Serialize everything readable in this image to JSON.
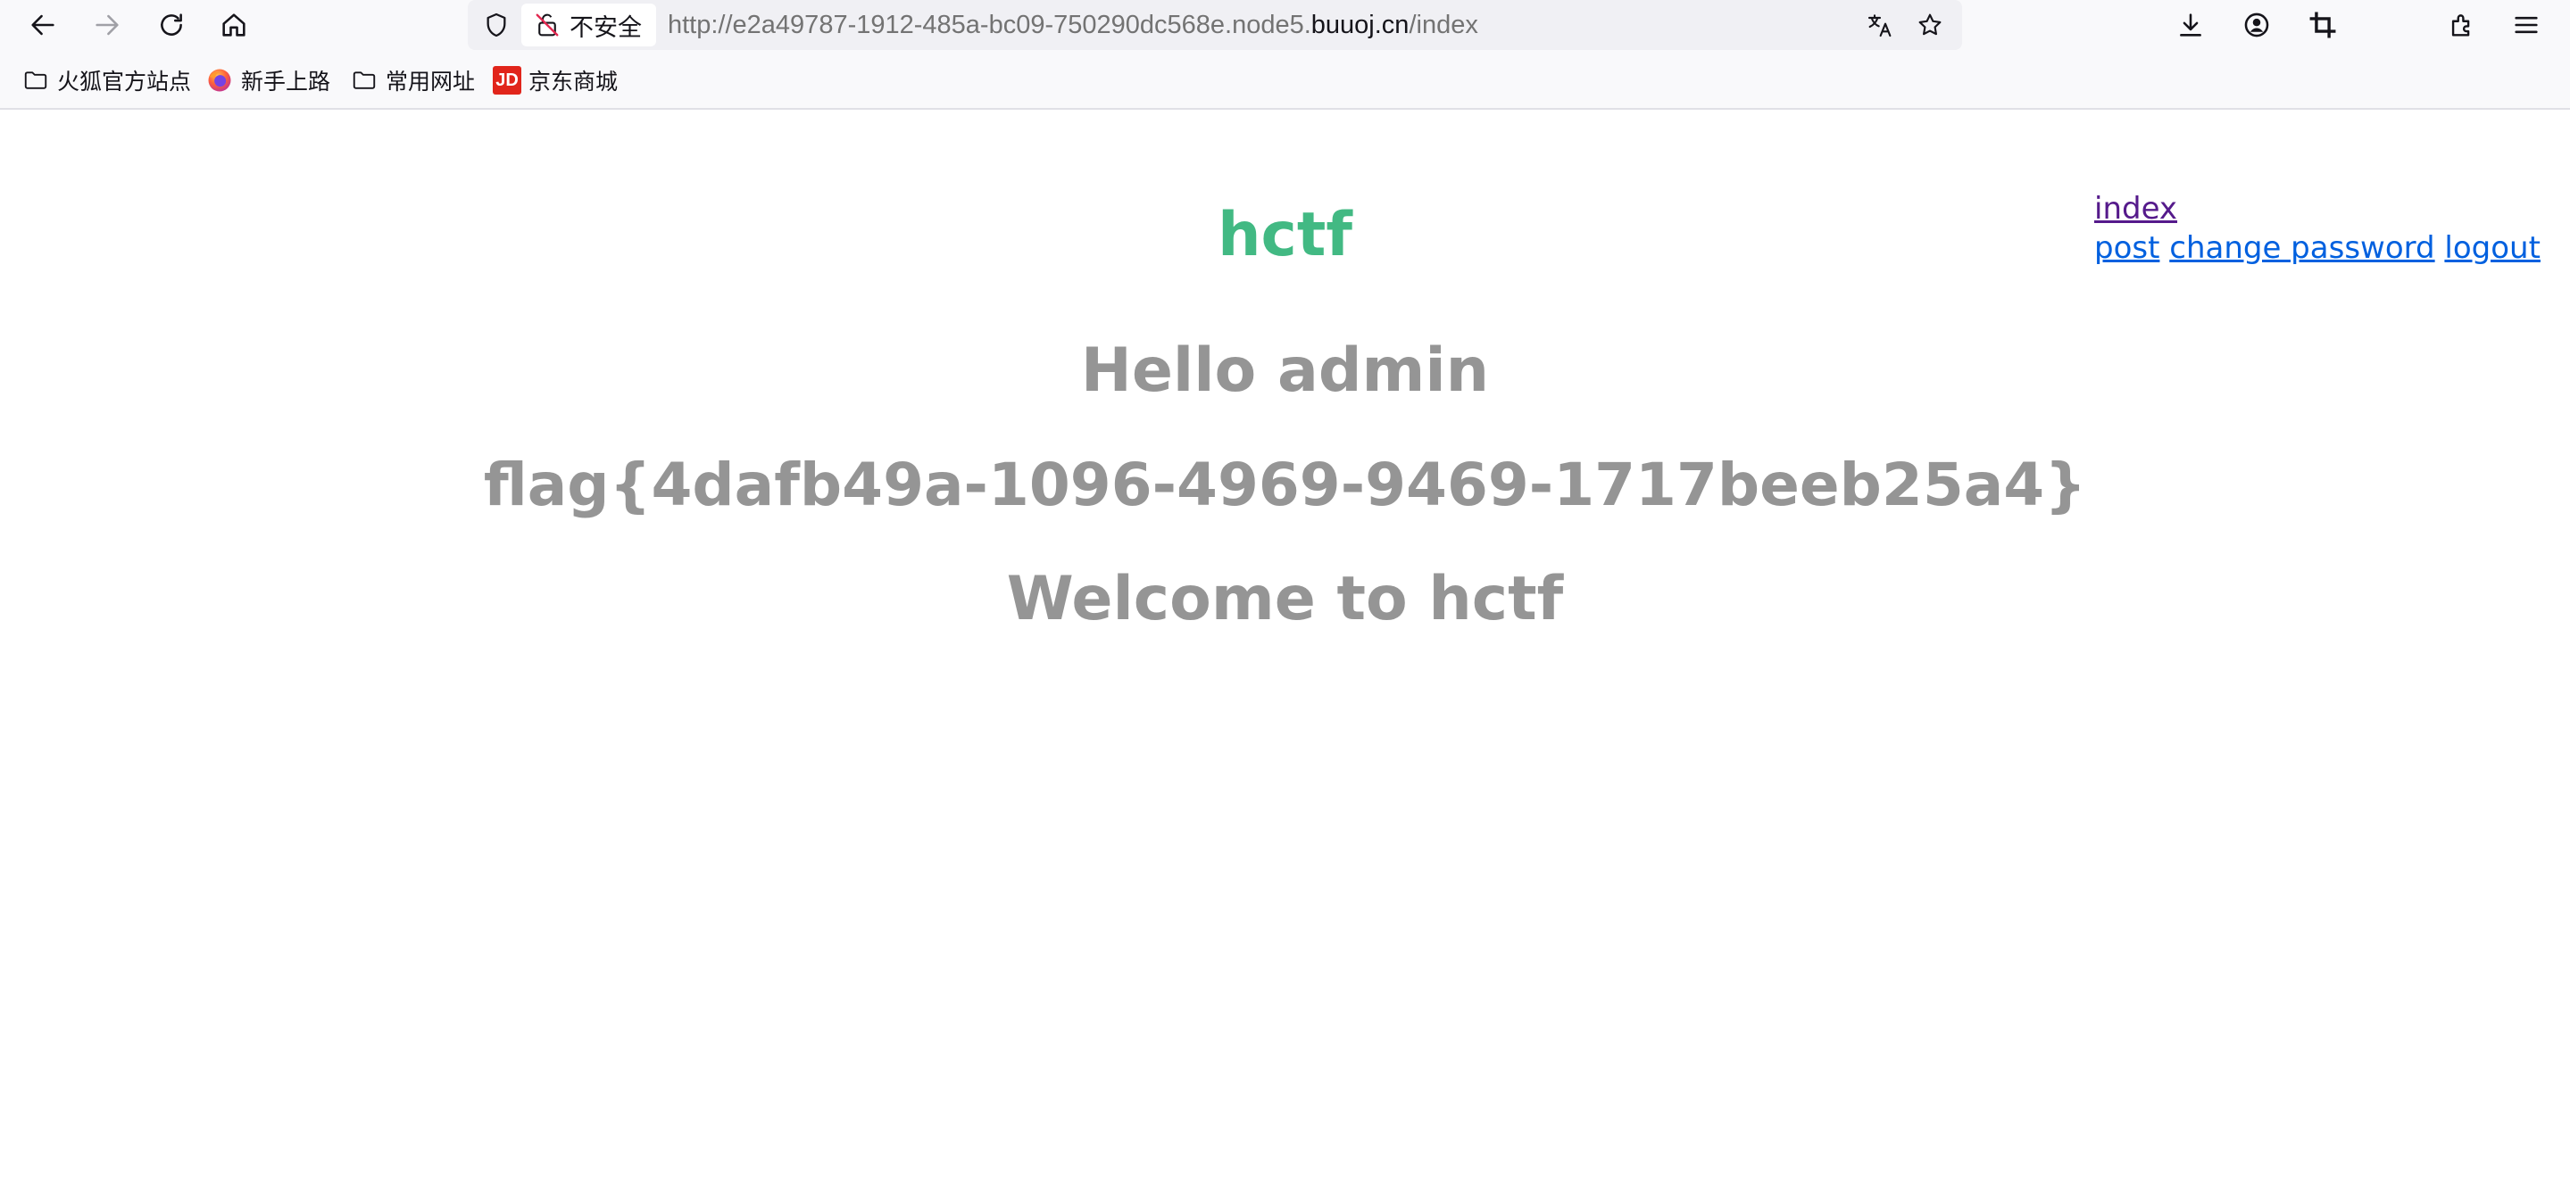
{
  "browser": {
    "security_label": "不安全",
    "url": {
      "prefix": "http://e2a49787-1912-485a-bc09-750290dc568e.node5.",
      "domain": "buuoj.cn",
      "path": "/index"
    },
    "icons": {
      "back": "back-arrow-icon",
      "forward": "forward-arrow-icon",
      "reload": "reload-icon",
      "home": "home-icon",
      "shield": "shield-icon",
      "insecure": "insecure-lock-icon",
      "translate": "translate-icon",
      "bookmark": "star-icon",
      "downloads": "download-icon",
      "account": "account-icon",
      "screenshot": "crop-icon",
      "extensions": "extensions-icon",
      "menu": "hamburger-menu-icon"
    }
  },
  "bookmarks": [
    {
      "label": "火狐官方站点",
      "icon": "folder-icon"
    },
    {
      "label": "新手上路",
      "icon": "firefox-icon"
    },
    {
      "label": "常用网址",
      "icon": "folder-icon"
    },
    {
      "label": "京东商城",
      "icon": "jd-icon",
      "icon_text": "JD"
    }
  ],
  "page": {
    "title": "hctf",
    "greeting": "Hello admin",
    "flag": "flag{4dafb49a-1096-4969-9469-1717beeb25a4}",
    "welcome": "Welcome to hctf",
    "nav": {
      "index": "index",
      "post": "post",
      "change_password": "change password",
      "logout": "logout"
    },
    "colors": {
      "title": "#42b983",
      "text": "#959595",
      "link": "#0060df",
      "visited_link": "#551a8b"
    }
  }
}
